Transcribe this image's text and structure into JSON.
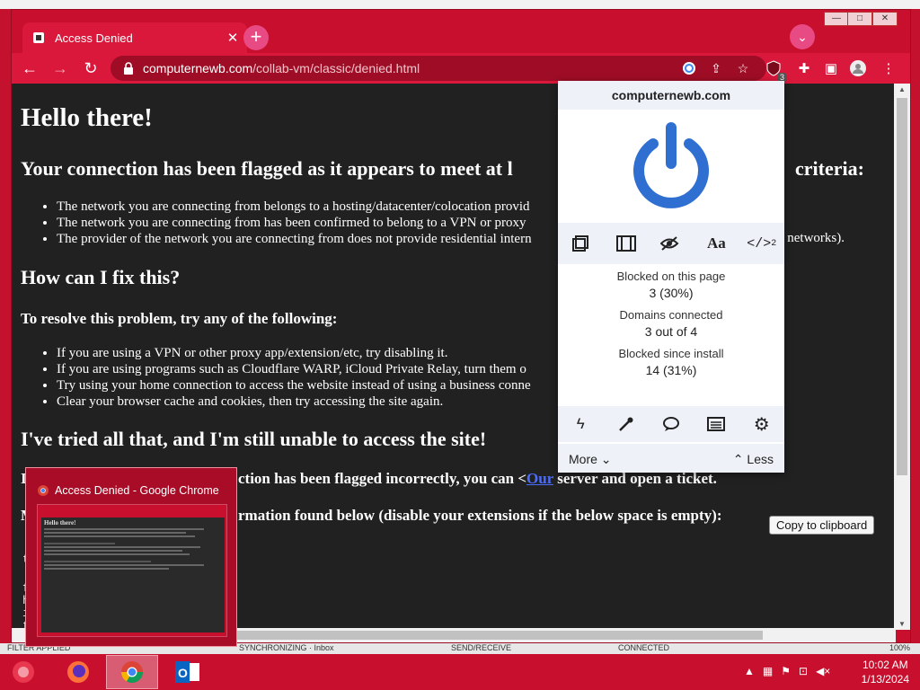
{
  "window": {
    "tab_title": "Access Denied",
    "url_host": "computernewb.com",
    "url_path": "/collab-vm/classic/denied.html",
    "extension_badge": "3"
  },
  "page": {
    "heading": "Hello there!",
    "flag_heading": "Your connection has been flagged as it appears to meet at l…criteria:",
    "flag_heading_left": "Your connection has been flagged as it appears to meet at l",
    "flag_heading_right": "criteria:",
    "criteria": [
      "The network you are connecting from belongs to a hosting/datacenter/colocation provid",
      "The network you are connecting from has been confirmed to belong to a VPN or proxy",
      "The provider of the network you are connecting from does not provide residential intern"
    ],
    "criteria_tail": "y networks).",
    "fix_heading": "How can I fix this?",
    "resolve_heading": "To resolve this problem, try any of the following:",
    "fixes": [
      "If you are using a VPN or other proxy app/extension/etc, try disabling it.",
      "If you are using programs such as Cloudflare WARP, iCloud Private Relay, turn them o",
      "Try using your home connection to access the website instead of using a business conne",
      "Clear your browser cache and cookies, then try accessing the site again."
    ],
    "tried_heading": "I've tried all that, and I'm still unable to access the site!",
    "ticket_para_left": "ction has been flagged incorrectly, you can <",
    "ticket_link": "Our",
    "ticket_para_right": " server and open a ticket.",
    "info_para": "rmation found below (disable your extensions if the below space is empty):",
    "copy_button": "Copy to clipboard",
    "left_letter_i": "I",
    "left_letter_m": "M"
  },
  "popup": {
    "domain": "computernewb.com",
    "blocked_page_label": "Blocked on this page",
    "blocked_page_value": "3 (30%)",
    "domains_label": "Domains connected",
    "domains_value": "3 out of 4",
    "blocked_install_label": "Blocked since install",
    "blocked_install_value": "14 (31%)",
    "more_label": "More",
    "less_label": "Less",
    "script_superscript": "2",
    "text_tool": "Aa"
  },
  "preview": {
    "title": "Access Denied - Google Chrome",
    "mini_heading": "Hello there!"
  },
  "statusbar": {
    "left": "FILTER APPLIED",
    "sync": "SYNCHRONIZING · Inbox",
    "send": "SEND/RECEIVE",
    "conn": "CONNECTED",
    "zoom": "100%"
  },
  "taskbar": {
    "time": "10:02 AM",
    "date": "1/13/2024"
  },
  "colors": {
    "accent": "#c8102e",
    "popup_blue": "#2f6fd1",
    "page_bg": "#212121"
  }
}
